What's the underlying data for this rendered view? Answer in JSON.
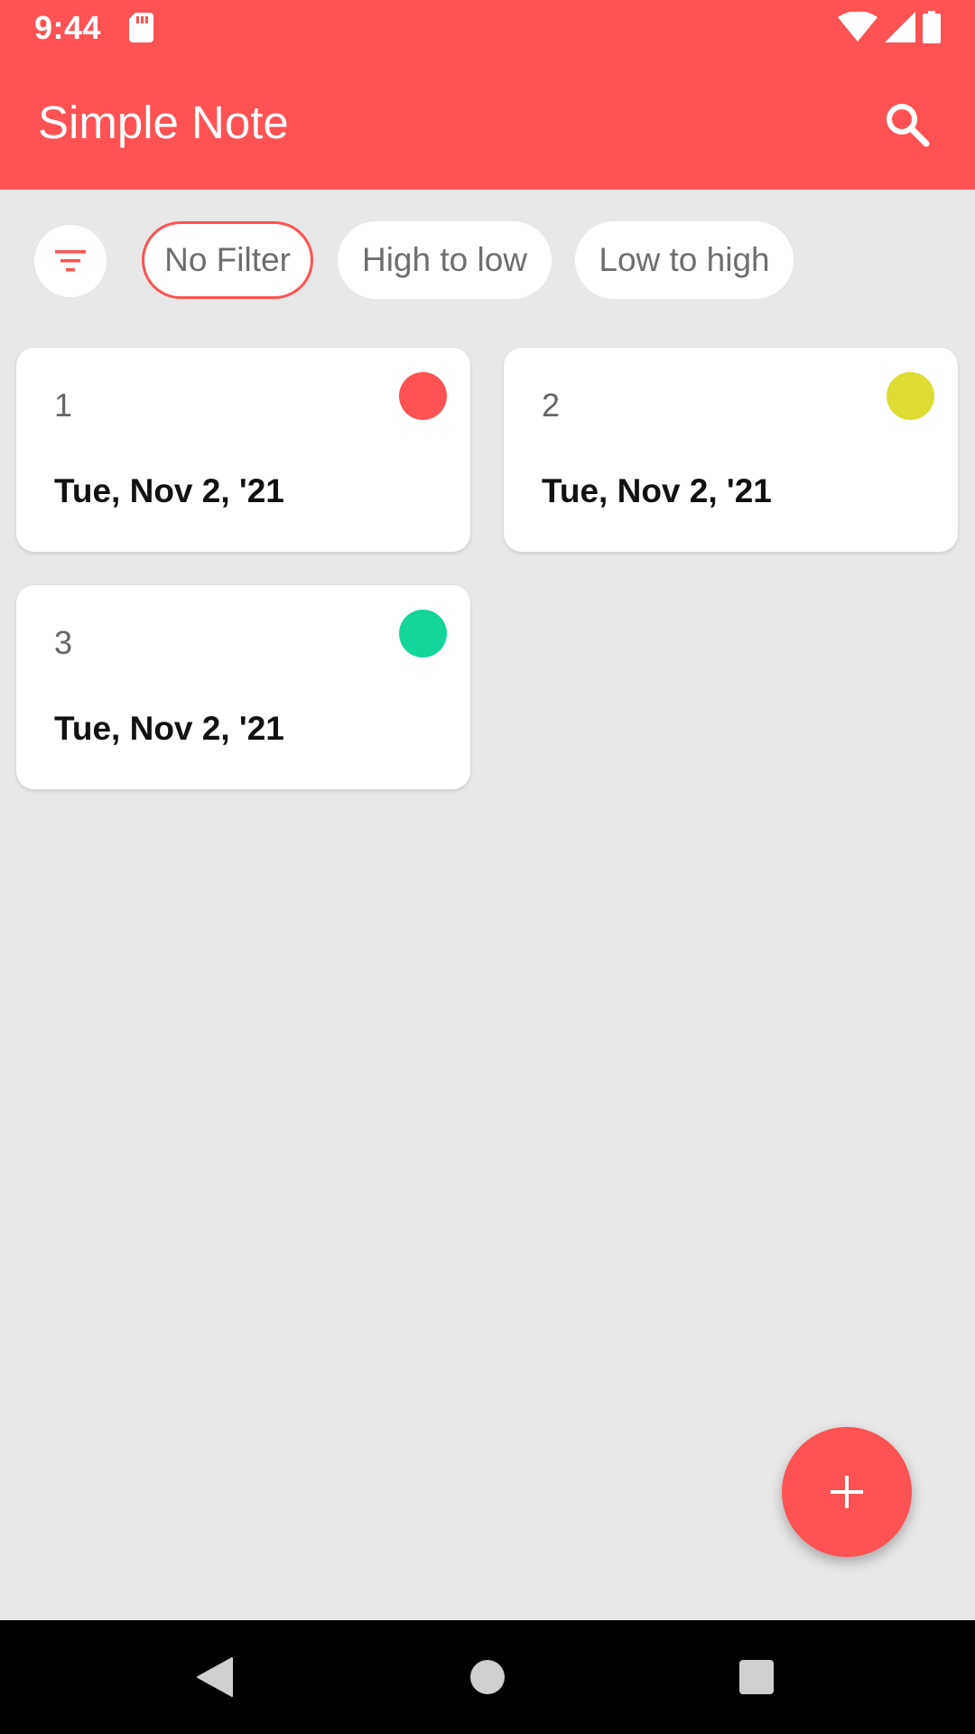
{
  "status_bar": {
    "time": "9:44",
    "icons": [
      "sd-card-icon",
      "wifi-icon",
      "cellular-signal-icon",
      "battery-icon"
    ]
  },
  "app_bar": {
    "title": "Simple Note",
    "action_icon": "search-icon"
  },
  "filters": {
    "icon": "filter-icon",
    "chips": [
      {
        "label": "No Filter",
        "selected": true
      },
      {
        "label": "High to low",
        "selected": false
      },
      {
        "label": "Low to high",
        "selected": false
      }
    ]
  },
  "notes": [
    {
      "title": "1",
      "date": "Tue, Nov 2, '21",
      "priority_color": "#ff5252"
    },
    {
      "title": "2",
      "date": "Tue, Nov 2, '21",
      "priority_color": "#dcdc32"
    },
    {
      "title": "3",
      "date": "Tue, Nov 2, '21",
      "priority_color": "#14d69a"
    }
  ],
  "fab": {
    "icon": "plus-icon"
  },
  "navigation": {
    "icons": [
      "back-icon",
      "home-icon",
      "recents-icon"
    ]
  },
  "colors": {
    "accent": "#ff5252",
    "background": "#e8e8e8",
    "card": "#ffffff"
  }
}
